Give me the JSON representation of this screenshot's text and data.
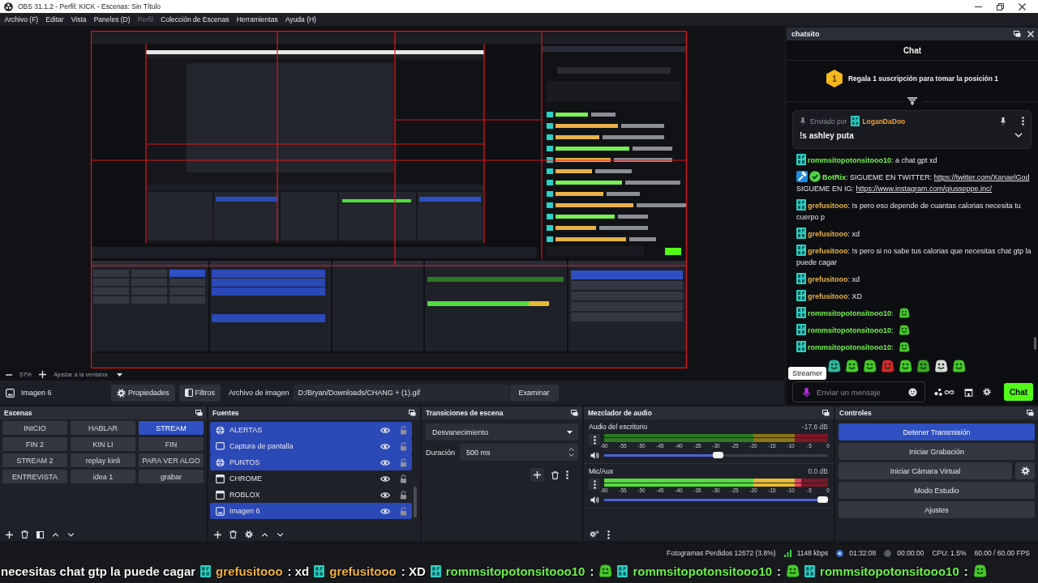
{
  "window": {
    "title": "OBS 31.1.2 - Perfil: KICK - Escenas: Sin Título"
  },
  "menu": [
    {
      "label": "Archivo (F)",
      "disabled": false
    },
    {
      "label": "Editar",
      "disabled": false
    },
    {
      "label": "Vista",
      "disabled": false
    },
    {
      "label": "Paneles (D)",
      "disabled": false
    },
    {
      "label": "Perfil",
      "disabled": true
    },
    {
      "label": "Colección de Escenas",
      "disabled": false
    },
    {
      "label": "Herramientas",
      "disabled": false
    },
    {
      "label": "Ayuda (H)",
      "disabled": false
    }
  ],
  "zoom_bar": {
    "scale": "57%",
    "fit": "Ajustar a la ventana"
  },
  "source_toolbar": {
    "source": "Imagen 6",
    "buttons": [
      {
        "label": "Propiedades",
        "kind": "properties"
      },
      {
        "label": "Filtros",
        "kind": "filters"
      }
    ],
    "file_label": "Archivo de imagen",
    "file_path": "D:/Bryan/Downloads/CHANG + (1).gif",
    "browse": "Examinar"
  },
  "scenes": {
    "title": "Escenas",
    "items": [
      {
        "label": "INICIO",
        "selected": false
      },
      {
        "label": "HABLAR",
        "selected": false
      },
      {
        "label": "STREAM",
        "selected": true
      },
      {
        "label": "FIN 2",
        "selected": false
      },
      {
        "label": "KIN LI",
        "selected": false
      },
      {
        "label": "FIN",
        "selected": false
      },
      {
        "label": "STREAM 2",
        "selected": false
      },
      {
        "label": "replay kinli",
        "selected": false
      },
      {
        "label": "PARA VER ALGO",
        "selected": false
      },
      {
        "label": "ENTREVISTA",
        "selected": false
      },
      {
        "label": "idea 1",
        "selected": false
      },
      {
        "label": "grabar",
        "selected": false
      }
    ]
  },
  "sources": {
    "title": "Fuentes",
    "items": [
      {
        "label": "ALERTAS",
        "kind": "browser",
        "selected": true,
        "visible": true,
        "locked": false
      },
      {
        "label": "Captura de pantalla",
        "kind": "display",
        "selected": true,
        "visible": true,
        "locked": false
      },
      {
        "label": "PUNTOS",
        "kind": "browser",
        "selected": true,
        "visible": true,
        "locked": false
      },
      {
        "label": "CHROME",
        "kind": "window",
        "selected": false,
        "visible": true,
        "locked": false
      },
      {
        "label": "ROBLOX",
        "kind": "window",
        "selected": false,
        "visible": true,
        "locked": false
      },
      {
        "label": "Imagen 6",
        "kind": "image",
        "selected": true,
        "visible": true,
        "locked": false
      }
    ]
  },
  "transitions": {
    "title": "Transiciones de escena",
    "transition": "Desvanecimiento",
    "duration_label": "Duración",
    "duration": "500 ms"
  },
  "mixer": {
    "title": "Mezclador de audio",
    "channels": [
      {
        "name": "Audio del escritorio",
        "reading": "-17.6 dB",
        "muted": false,
        "volume": {
          "level": 0.51
        },
        "scale": [
          "-60",
          "-55",
          "-50",
          "-45",
          "-40",
          "-35",
          "-30",
          "-25",
          "-20",
          "-15",
          "-10",
          "-5",
          "0"
        ]
      },
      {
        "name": "Mic/Aux",
        "reading": "0.0 dB",
        "muted": false,
        "meter": {
          "level": 0.88
        },
        "volume": {
          "level": 1
        },
        "scale": [
          "-60",
          "-55",
          "-50",
          "-45",
          "-40",
          "-35",
          "-30",
          "-25",
          "-20",
          "-15",
          "-10",
          "-5",
          "0"
        ]
      }
    ]
  },
  "controls": {
    "title": "Controles",
    "buttons": [
      {
        "label": "Detener Transmisión",
        "active": true,
        "kind": "plain"
      },
      {
        "label": "Iniciar Grabación",
        "active": false,
        "kind": "plain"
      },
      {
        "label": "Iniciar Cámara Virtual",
        "active": false,
        "kind": "with_settings"
      },
      {
        "label": "Modo Estudio",
        "active": false,
        "kind": "plain"
      },
      {
        "label": "Ajustes",
        "active": false,
        "kind": "plain"
      }
    ]
  },
  "status_bar": {
    "dropped_frames": "Fotogramas Perdidos 12672 (3.8%)",
    "bitrate": "1148 kbps",
    "stream_time": "01:32:08",
    "streaming": true,
    "record_time": "00:00:00",
    "recording": false,
    "cpu": "CPU: 1.5%",
    "fps": "60.00 / 60.00 FPS"
  },
  "chat": {
    "title": "chatsito",
    "header": "Chat",
    "gift": {
      "badge": "1",
      "text": "Regala 1 suscripción para tomar la posición 1"
    },
    "pinned": {
      "prefix": "Enviado por",
      "user": "LoganDaDoo",
      "color": "#ec9f3a",
      "text": "!s ashley puta"
    },
    "messages": [
      {
        "kind": "subscriber",
        "user": "rommsitopotonsitooo10",
        "color": "#76f052",
        "content": [
          {
            "kind": "text",
            "text": ": a chat gpt xd"
          }
        ]
      },
      {
        "kind": "moderator",
        "user": "BotRix",
        "color": "#76f052",
        "content": [
          {
            "kind": "text",
            "text": ": SIGUEME EN TWITTER: "
          },
          {
            "kind": "link",
            "text": "https://twitter.com/XanaelGod"
          },
          {
            "kind": "text",
            "text": " SIGUEME EN IG: "
          },
          {
            "kind": "link",
            "text": "https://www.instagram.com/giusseppe.inc/"
          }
        ]
      },
      {
        "kind": "subscriber",
        "user": "grefusitooo",
        "color": "#e8b249",
        "content": [
          {
            "kind": "text",
            "text": ": !s pero eso depende de cuantas calorias necesita tu cuerpo p"
          }
        ]
      },
      {
        "kind": "subscriber",
        "user": "grefusitooo",
        "color": "#e8b249",
        "content": [
          {
            "kind": "text",
            "text": ": xd"
          }
        ]
      },
      {
        "kind": "subscriber",
        "user": "grefusitooo",
        "color": "#e8b249",
        "content": [
          {
            "kind": "text",
            "text": ": !s pero si no sabe tus calorias que necesitas chat gtp la puede cagar"
          }
        ]
      },
      {
        "kind": "subscriber",
        "user": "grefusitooo",
        "color": "#e8b249",
        "content": [
          {
            "kind": "text",
            "text": ": xd"
          }
        ]
      },
      {
        "kind": "subscriber",
        "user": "grefusitooo",
        "color": "#e8b249",
        "content": [
          {
            "kind": "text",
            "text": ": XD"
          }
        ]
      },
      {
        "kind": "subscriber",
        "user": "rommsitopotonsitooo10",
        "color": "#76f052",
        "content": [
          {
            "kind": "text",
            "text": ":"
          },
          {
            "kind": "emote"
          }
        ]
      },
      {
        "kind": "subscriber",
        "user": "rommsitopotonsitooo10",
        "color": "#76f052",
        "content": [
          {
            "kind": "text",
            "text": ":"
          },
          {
            "kind": "emote"
          }
        ]
      },
      {
        "kind": "subscriber",
        "user": "rommsitopotonsitooo10",
        "color": "#76f052",
        "content": [
          {
            "kind": "text",
            "text": ":"
          },
          {
            "kind": "emote"
          }
        ]
      }
    ],
    "tooltip": "Streamer",
    "input": {
      "placeholder": "Enviar un mensaje"
    },
    "send": "Chat"
  },
  "ticker": [
    {
      "kind": "text",
      "text": "necesitas chat gtp la puede cagar"
    },
    {
      "kind": "badge"
    },
    {
      "kind": "user",
      "text": "grefusitooo",
      "color": "#f0b23c"
    },
    {
      "kind": "text",
      "text": ": xd"
    },
    {
      "kind": "badge"
    },
    {
      "kind": "user",
      "text": "grefusitooo",
      "color": "#f0b23c"
    },
    {
      "kind": "text",
      "text": ": XD"
    },
    {
      "kind": "badge"
    },
    {
      "kind": "user",
      "text": "rommsitopotonsitooo10",
      "color": "#6cf04a"
    },
    {
      "kind": "text",
      "text": ":"
    },
    {
      "kind": "emote"
    },
    {
      "kind": "badge"
    },
    {
      "kind": "user",
      "text": "rommsitopotonsitooo10",
      "color": "#6cf04a"
    },
    {
      "kind": "text",
      "text": ":"
    },
    {
      "kind": "emote"
    },
    {
      "kind": "badge"
    },
    {
      "kind": "user",
      "text": "rommsitopotonsitooo10",
      "color": "#6cf04a"
    },
    {
      "kind": "text",
      "text": ":"
    },
    {
      "kind": "emote"
    }
  ]
}
